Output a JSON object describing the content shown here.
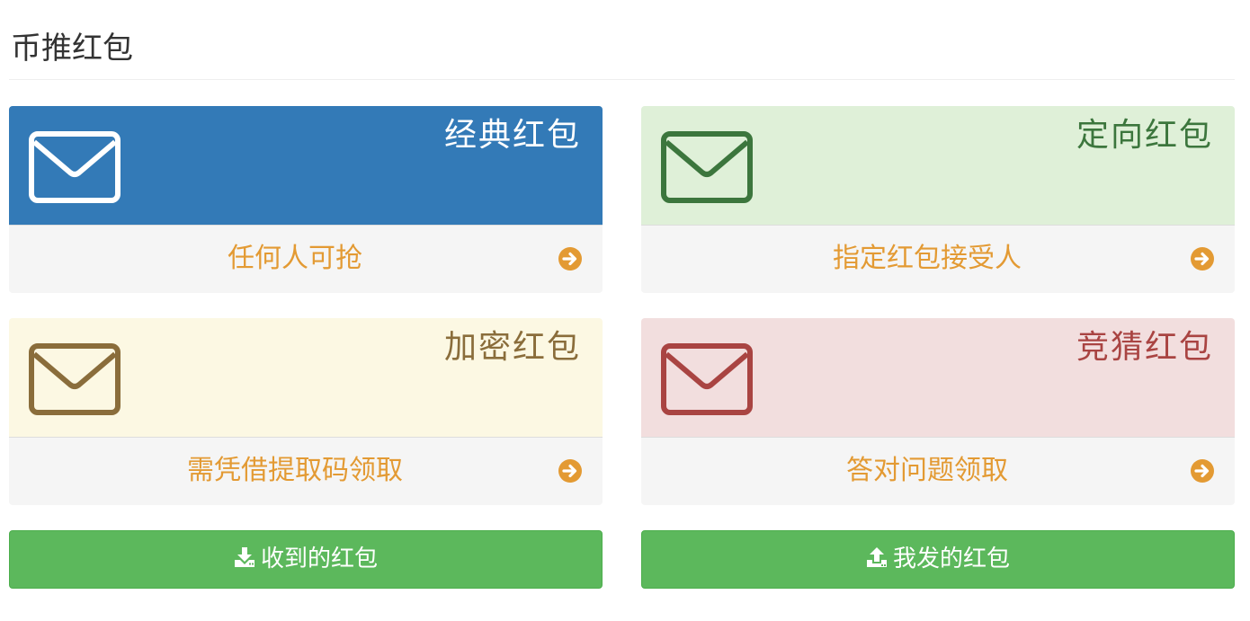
{
  "page": {
    "title": "币推红包"
  },
  "panels": [
    {
      "title": "经典红包",
      "subtitle": "任何人可抢",
      "icon": "envelope-icon",
      "head_bg": "#337ab7",
      "head_color": "#ffffff"
    },
    {
      "title": "定向红包",
      "subtitle": "指定红包接受人",
      "icon": "envelope-icon",
      "head_bg": "#dff0d8",
      "head_color": "#3c763d"
    },
    {
      "title": "加密红包",
      "subtitle": "需凭借提取码领取",
      "icon": "envelope-icon",
      "head_bg": "#fcf8e3",
      "head_color": "#8a6d3b"
    },
    {
      "title": "竞猜红包",
      "subtitle": "答对问题领取",
      "icon": "envelope-icon",
      "head_bg": "#f2dede",
      "head_color": "#a94442"
    }
  ],
  "footer_arrow_icon": "arrow-circle-right-icon",
  "footer_text_color": "#e39a33",
  "buttons": {
    "received": {
      "label": "收到的红包",
      "icon": "download-icon"
    },
    "sent": {
      "label": "我发的红包",
      "icon": "upload-icon"
    },
    "color": "#5cb85c"
  }
}
